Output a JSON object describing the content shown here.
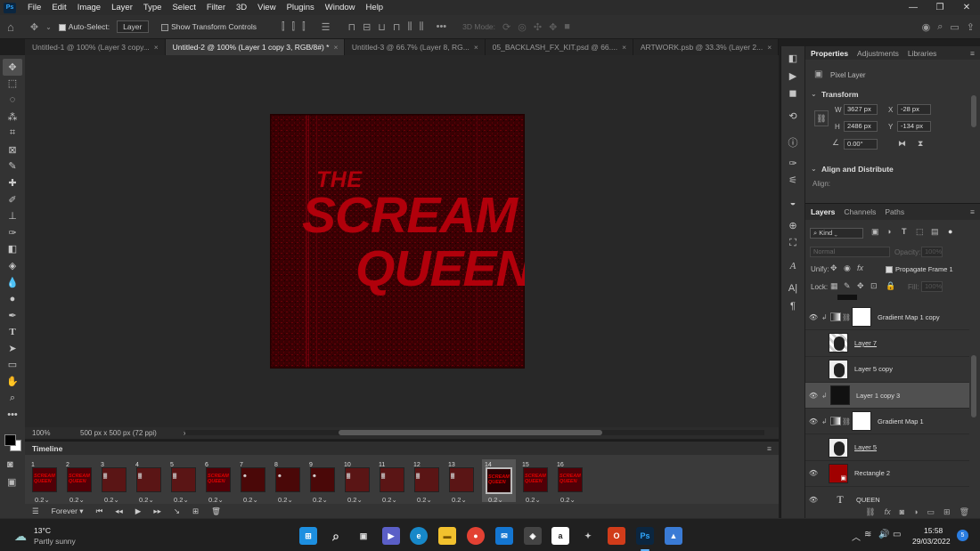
{
  "menu": {
    "items": [
      "File",
      "Edit",
      "Image",
      "Layer",
      "Type",
      "Select",
      "Filter",
      "3D",
      "View",
      "Plugins",
      "Window",
      "Help"
    ],
    "window_controls": [
      "—",
      "❐",
      "✕"
    ]
  },
  "options": {
    "auto_select_label": "Auto-Select:",
    "auto_select_value": "Layer",
    "show_transform_label": "Show Transform Controls",
    "three_d_mode_label": "3D Mode:"
  },
  "tabs": [
    {
      "label": "Untitled-1 @ 100% (Layer 3 copy...",
      "active": false
    },
    {
      "label": "Untitled-2 @ 100% (Layer 1 copy 3, RGB/8#) *",
      "active": true
    },
    {
      "label": "Untitled-3 @ 66.7% (Layer 8, RG...",
      "active": false
    },
    {
      "label": "05_BACKLASH_FX_KIT.psd @ 66....",
      "active": false
    },
    {
      "label": "ARTWORK.psb @ 33.3% (Layer 2...",
      "active": false
    }
  ],
  "artwork": {
    "line1": "THE",
    "line2": "SCREAM",
    "line3": "QUEEN",
    "text_color": "#b1000b",
    "bg_color": "#3a0003"
  },
  "status": {
    "zoom": "100%",
    "doc_size": "500 px x 500 px (72 ppi)"
  },
  "timeline": {
    "title": "Timeline",
    "loop": "Forever",
    "frames": [
      {
        "num": "1",
        "dur": "0.2"
      },
      {
        "num": "2",
        "dur": "0.2"
      },
      {
        "num": "3",
        "dur": "0.2"
      },
      {
        "num": "4",
        "dur": "0.2"
      },
      {
        "num": "5",
        "dur": "0.2"
      },
      {
        "num": "6",
        "dur": "0.2"
      },
      {
        "num": "7",
        "dur": "0.2"
      },
      {
        "num": "8",
        "dur": "0.2"
      },
      {
        "num": "9",
        "dur": "0.2"
      },
      {
        "num": "10",
        "dur": "0.2"
      },
      {
        "num": "11",
        "dur": "0.2"
      },
      {
        "num": "12",
        "dur": "0.2"
      },
      {
        "num": "13",
        "dur": "0.2"
      },
      {
        "num": "14",
        "dur": "0.2"
      },
      {
        "num": "15",
        "dur": "0.2"
      },
      {
        "num": "16",
        "dur": "0.2"
      }
    ],
    "selected_frame": 14
  },
  "properties": {
    "tabs": [
      "Properties",
      "Adjustments",
      "Libraries"
    ],
    "kind": "Pixel Layer",
    "transform_title": "Transform",
    "w_label": "W",
    "w": "3627 px",
    "h_label": "H",
    "h": "2486 px",
    "x_label": "X",
    "x": "-28 px",
    "y_label": "Y",
    "y": "-134 px",
    "angle": "0.00°",
    "align_title": "Align and Distribute",
    "align_label": "Align:"
  },
  "layers_panel": {
    "tabs": [
      "Layers",
      "Channels",
      "Paths"
    ],
    "kind": "Kind",
    "blend": "Normal",
    "opacity_label": "Opacity:",
    "opacity": "100%",
    "unify_label": "Unify:",
    "propagate_label": "Propagate Frame 1",
    "lock_label": "Lock:",
    "fill_label": "Fill:",
    "fill": "100%",
    "layers": [
      {
        "name": "Gradient Map 1 copy",
        "visible": true,
        "type": "gradient",
        "selected": false
      },
      {
        "name": "Layer 7",
        "visible": false,
        "type": "photo",
        "selected": false
      },
      {
        "name": "Layer 5 copy",
        "visible": false,
        "type": "photo",
        "selected": false
      },
      {
        "name": "Layer 1 copy 3",
        "visible": true,
        "type": "dark",
        "selected": true
      },
      {
        "name": "Gradient Map 1",
        "visible": true,
        "type": "gradient",
        "selected": false
      },
      {
        "name": "Layer 5",
        "visible": false,
        "type": "photo",
        "selected": false
      },
      {
        "name": "Rectangle 2",
        "visible": true,
        "type": "red",
        "selected": false
      },
      {
        "name": "QUEEN",
        "visible": true,
        "type": "text",
        "selected": false
      }
    ]
  },
  "taskbar": {
    "temp": "13°C",
    "weather": "Partly sunny",
    "time": "15:58",
    "date": "29/03/2022"
  }
}
